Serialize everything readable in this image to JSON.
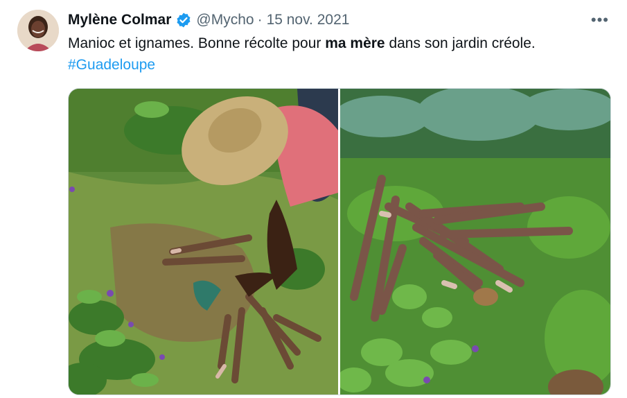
{
  "tweet": {
    "author_name": "Mylène Colmar",
    "handle": "@Mycho",
    "separator": "·",
    "date": "15 nov. 2021",
    "text_part1": "Manioc et ignames. Bonne récolte pour ",
    "text_bold": "ma mère",
    "text_part2": " dans son jardin créole.",
    "hashtag": "#Guadeloupe",
    "more_label": "•••"
  },
  "icons": {
    "verified": "verified-badge-icon",
    "more": "more-options-icon"
  },
  "colors": {
    "link": "#1d9bf0",
    "secondary_text": "#536471",
    "verified": "#1d9bf0"
  }
}
